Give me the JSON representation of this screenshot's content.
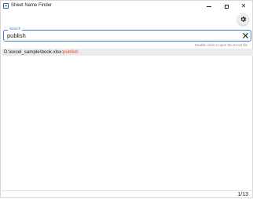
{
  "window": {
    "title": "Sheet Name Finder"
  },
  "search": {
    "legend": "Search",
    "value": "publish",
    "hint": "Double click to open the Excel file"
  },
  "results": [
    {
      "path": "D:\\excel_sample\\book.xlsx:",
      "sheet": "publish"
    }
  ],
  "status": {
    "page_count": "1/13"
  },
  "colors": {
    "accent": "#3a7bd5",
    "match_highlight": "#e0522f",
    "row_background": "#ebebeb"
  },
  "icons": {
    "app": "app-icon",
    "settings": "gear-icon",
    "clear": "close-icon"
  }
}
